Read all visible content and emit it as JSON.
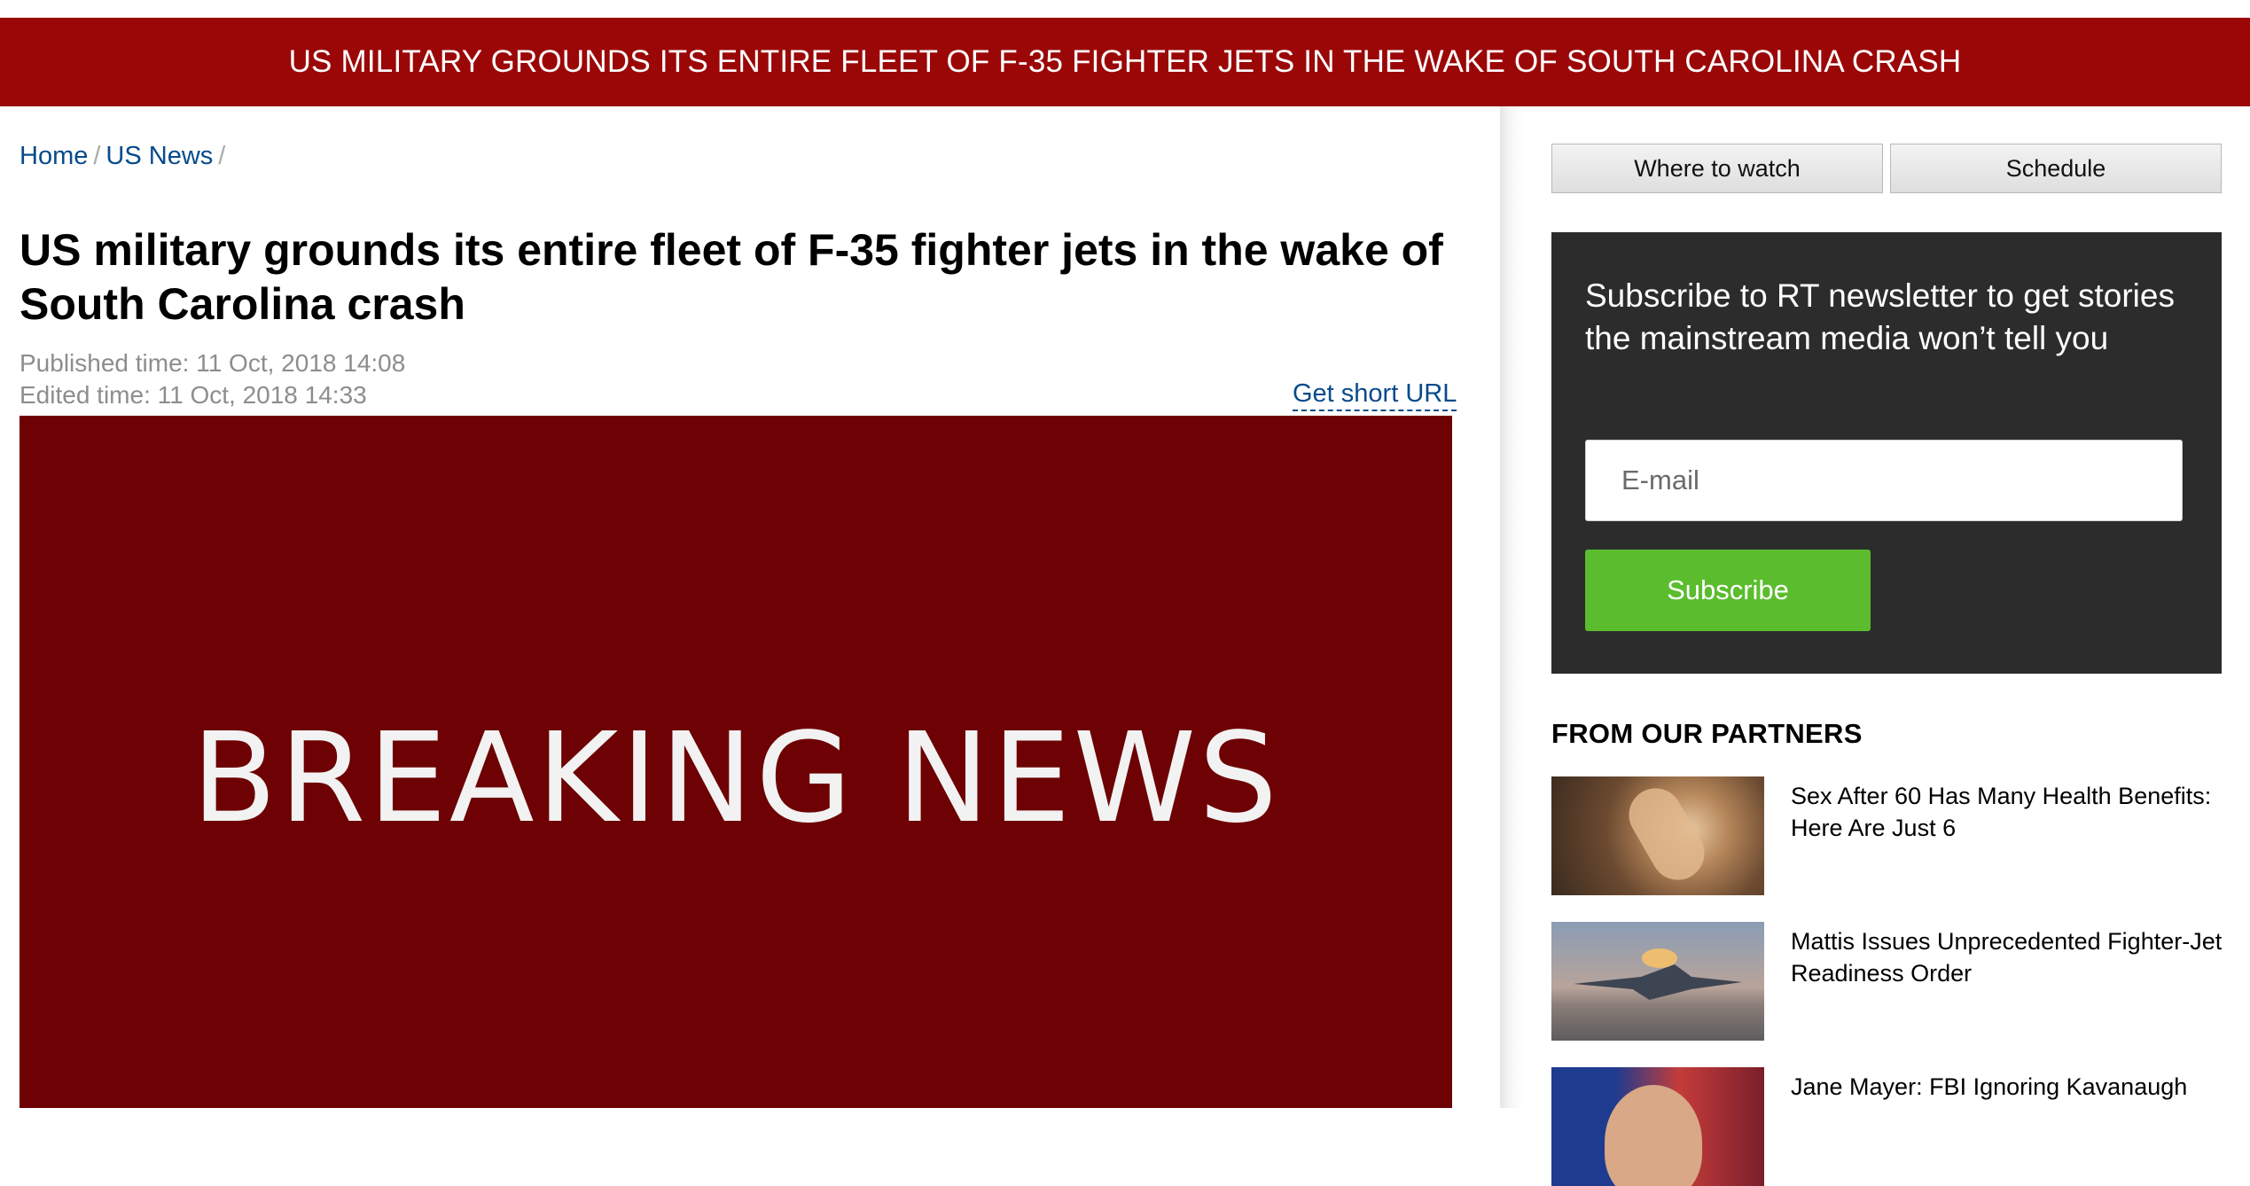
{
  "banner": {
    "text": "US MILITARY GROUNDS ITS ENTIRE FLEET OF F-35 FIGHTER JETS IN THE WAKE OF SOUTH CAROLINA CRASH"
  },
  "breadcrumb": {
    "items": [
      "Home",
      "US News"
    ],
    "separator": "/"
  },
  "article": {
    "headline": "US military grounds its entire fleet of F-35 fighter jets in the wake of South Carolina crash",
    "published": "Published time: 11 Oct, 2018 14:08",
    "edited": "Edited time: 11 Oct, 2018 14:33",
    "short_url_label": "Get short URL",
    "hero_text": "BREAKING NEWS"
  },
  "sidebar": {
    "tabs": [
      "Where to watch",
      "Schedule"
    ],
    "newsletter": {
      "title": "Subscribe to RT newsletter to get stories the mainstream media won’t tell you",
      "email_placeholder": "E-mail",
      "button_label": "Subscribe"
    },
    "partners": {
      "title": "FROM OUR PARTNERS",
      "items": [
        {
          "text": "Sex After 60 Has Many Health Benefits: Here Are Just 6"
        },
        {
          "text": "Mattis Issues Unprecedented Fighter-Jet Readiness Order"
        },
        {
          "text": "Jane Mayer: FBI Ignoring Kavanaugh"
        }
      ]
    }
  },
  "colors": {
    "banner_bg": "#9b0707",
    "hero_bg": "#6d0103",
    "link": "#074a8b",
    "newsletter_bg": "#2c2c2c",
    "subscribe_button": "#5bbd2e"
  }
}
